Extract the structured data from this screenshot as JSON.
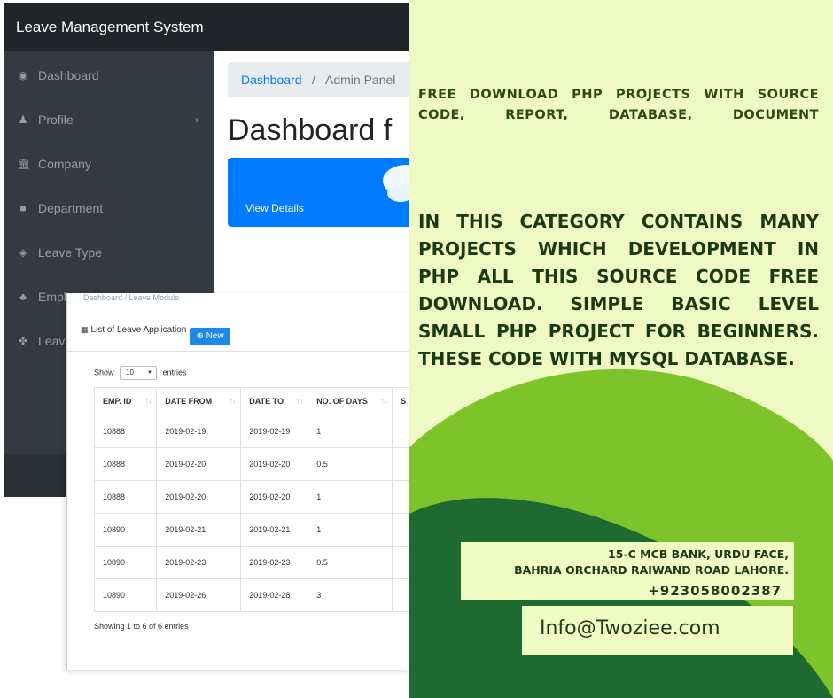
{
  "dashboard": {
    "app_title": "Leave Management System",
    "sidebar": [
      {
        "label": "Dashboard",
        "icon": "dashboard-icon",
        "glyph": "◉"
      },
      {
        "label": "Profile",
        "icon": "user-icon",
        "glyph": "♟",
        "chevron": "›"
      },
      {
        "label": "Company",
        "icon": "bank-icon",
        "glyph": "🏛"
      },
      {
        "label": "Department",
        "icon": "folder-icon",
        "glyph": "■"
      },
      {
        "label": "Leave Type",
        "icon": "cube-icon",
        "glyph": "◈"
      },
      {
        "label": "Employee",
        "icon": "users-icon",
        "glyph": "♣"
      },
      {
        "label": "Leav",
        "icon": "cubes-icon",
        "glyph": "✤"
      }
    ],
    "breadcrumb": {
      "home": "Dashboard",
      "separator": "/",
      "current": "Admin Panel"
    },
    "page_title": "Dashboard f",
    "card_link": "View Details"
  },
  "leave_list": {
    "breadcrumb": "Dashboard / Leave Module",
    "heading": "List of Leave Application",
    "new_button": "New",
    "show_label": "Show",
    "entries_value": "10",
    "entries_label": "entries",
    "columns": [
      "EMP. ID",
      "DATE FROM",
      "DATE TO",
      "NO. OF DAYS",
      "S"
    ],
    "rows": [
      [
        "10888",
        "2019-02-19",
        "2019-02-19",
        "1"
      ],
      [
        "10888",
        "2019-02-20",
        "2019-02-20",
        "0.5"
      ],
      [
        "10888",
        "2019-02-20",
        "2019-02-20",
        "1"
      ],
      [
        "10890",
        "2019-02-21",
        "2019-02-21",
        "1"
      ],
      [
        "10890",
        "2019-02-23",
        "2019-02-23",
        "0.5"
      ],
      [
        "10890",
        "2019-02-26",
        "2019-02-28",
        "3"
      ]
    ],
    "info": "Showing 1 to 6 of 6 entries"
  },
  "promo": {
    "headline": "FREE DOWNLOAD PHP PROJECTS WITH SOURCE CODE, REPORT, DATABASE, DOCUMENT",
    "body": "IN THIS CATEGORY CONTAINS MANY PROJECTS WHICH DEVELOPMENT IN PHP ALL THIS SOURCE CODE FREE DOWNLOAD. SIMPLE BASIC LEVEL SMALL PHP PROJECT FOR BEGINNERS. THESE CODE WITH MYSQL DATABASE.",
    "address_line1": "15-C MCB BANK, URDU FACE,",
    "address_line2": "BAHRIA ORCHARD RAIWAND ROAD LAHORE.",
    "phone": "+923058002387",
    "email": "Info@Twoziee.com"
  },
  "colors": {
    "promo_bg": "#eff9c3",
    "light_green": "#7dc42a",
    "dark_green": "#1f6a30",
    "navbar": "#212529",
    "sidebar": "#343a40",
    "primary": "#007bff"
  }
}
